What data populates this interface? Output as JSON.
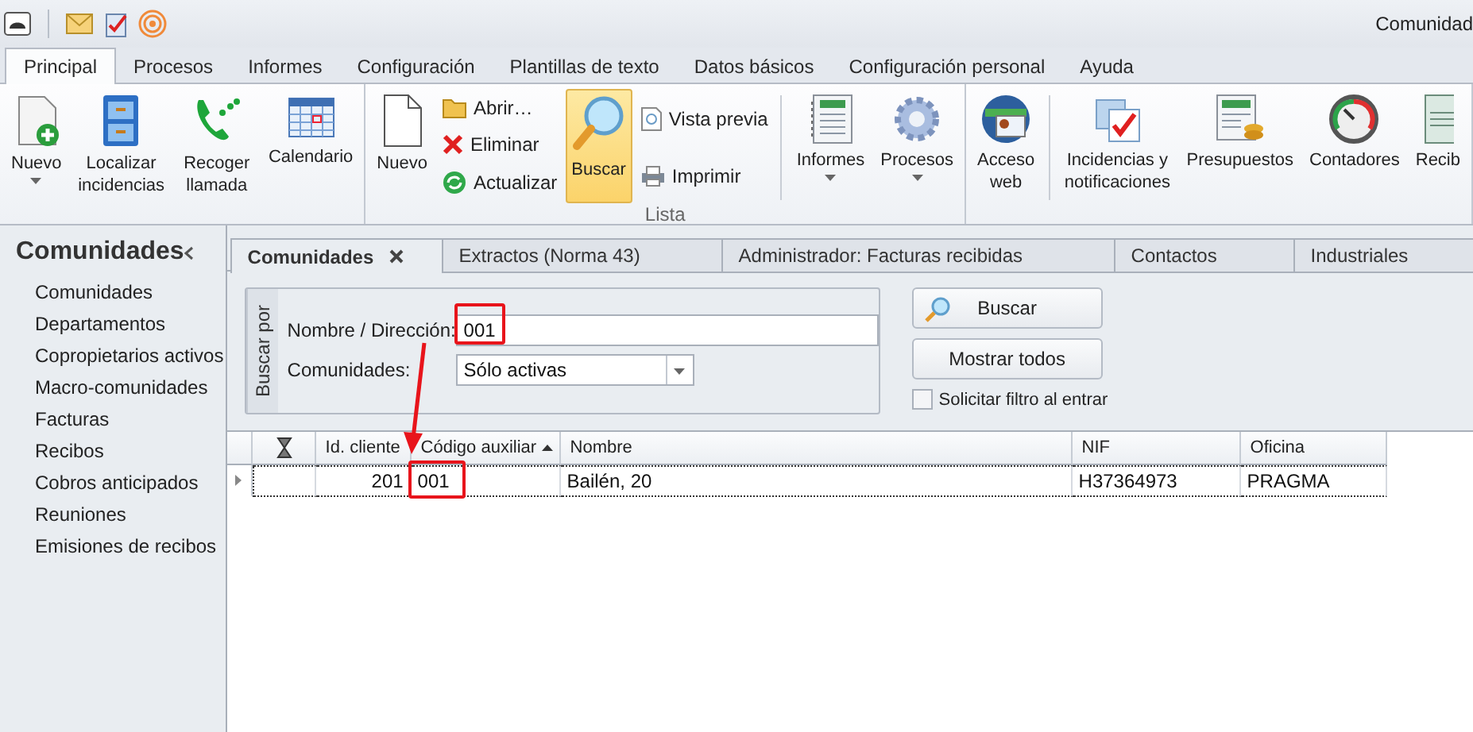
{
  "window": {
    "title": "Comunidad"
  },
  "ribbon_tabs": [
    {
      "label": "Principal",
      "selected": true
    },
    {
      "label": "Procesos",
      "selected": false
    },
    {
      "label": "Informes",
      "selected": false
    },
    {
      "label": "Configuración",
      "selected": false
    },
    {
      "label": "Plantillas de texto",
      "selected": false
    },
    {
      "label": "Datos básicos",
      "selected": false
    },
    {
      "label": "Configuración personal",
      "selected": false
    },
    {
      "label": "Ayuda",
      "selected": false
    }
  ],
  "ribbon_groups": [
    {
      "items": [
        {
          "kind": "large",
          "label": "Nuevo",
          "dropdown": true,
          "pressed": false
        },
        {
          "kind": "large",
          "label": "Localizar incidencias",
          "dropdown": false,
          "pressed": false
        },
        {
          "kind": "large",
          "label": "Recoger llamada",
          "dropdown": false,
          "pressed": false
        },
        {
          "kind": "large",
          "label": "Calendario",
          "dropdown": false,
          "pressed": false
        }
      ]
    },
    {
      "label": "Lista",
      "items": [
        {
          "kind": "large",
          "label": "Nuevo",
          "dropdown": false,
          "pressed": false
        },
        {
          "kind": "stack",
          "labels": [
            "Abrir…",
            "Eliminar",
            "Actualizar"
          ]
        },
        {
          "kind": "large",
          "label": "Buscar",
          "dropdown": false,
          "pressed": true
        },
        {
          "kind": "stack",
          "labels": [
            "Vista previa",
            "Imprimir"
          ]
        },
        {
          "kind": "separator"
        },
        {
          "kind": "large",
          "label": "Informes",
          "dropdown": true,
          "pressed": false
        },
        {
          "kind": "large",
          "label": "Procesos",
          "dropdown": true,
          "pressed": false
        }
      ]
    },
    {
      "items": [
        {
          "kind": "large",
          "label": "Acceso web",
          "dropdown": false,
          "pressed": false
        },
        {
          "kind": "separator"
        },
        {
          "kind": "large",
          "label": "Incidencias y notificaciones",
          "dropdown": false,
          "pressed": false
        },
        {
          "kind": "large",
          "label": "Presupuestos",
          "dropdown": false,
          "pressed": false
        },
        {
          "kind": "large",
          "label": "Contadores",
          "dropdown": false,
          "pressed": false
        },
        {
          "kind": "large",
          "label": "Recib",
          "dropdown": false,
          "pressed": false
        }
      ]
    }
  ],
  "sidebar": {
    "title": "Comunidades",
    "items": [
      "Comunidades",
      "Departamentos",
      "Copropietarios activos",
      "Macro-comunidades",
      "Facturas",
      "Recibos",
      "Cobros anticipados",
      "Reuniones",
      "Emisiones de recibos"
    ]
  },
  "doc_tabs": [
    {
      "label": "Comunidades",
      "selected": true,
      "closable": true
    },
    {
      "label": "Extractos (Norma 43)",
      "selected": false,
      "closable": false
    },
    {
      "label": "Administrador: Facturas recibidas",
      "selected": false,
      "closable": false
    },
    {
      "label": "Contactos",
      "selected": false,
      "closable": false
    },
    {
      "label": "Industriales",
      "selected": false,
      "closable": false
    }
  ],
  "filter": {
    "group_label": "Buscar por",
    "name_label": "Nombre / Dirección:",
    "name_value": "001",
    "name_highlighted": true,
    "status_label": "Comunidades:",
    "status_value": "Sólo activas",
    "search_button": "Buscar",
    "show_all_button": "Mostrar todos",
    "ask_filter": {
      "label": "Solicitar filtro al entrar",
      "checked": false
    }
  },
  "table": {
    "columns": [
      {
        "label": "Id. cliente",
        "sorted_ascending": false
      },
      {
        "label": "Código auxiliar",
        "sorted_ascending": true
      },
      {
        "label": "Nombre",
        "sorted_ascending": false
      },
      {
        "label": "NIF",
        "sorted_ascending": false
      },
      {
        "label": "Oficina",
        "sorted_ascending": false
      }
    ],
    "rows": [
      {
        "selected": true,
        "cells": [
          {
            "text": "201",
            "highlighted": false
          },
          {
            "text": "001",
            "highlighted": true
          },
          {
            "text": "Bailén, 20",
            "highlighted": false
          },
          {
            "text": "H37364973",
            "highlighted": false
          },
          {
            "text": "PRAGMA",
            "highlighted": false
          }
        ]
      }
    ]
  },
  "annotation_arrow": true
}
